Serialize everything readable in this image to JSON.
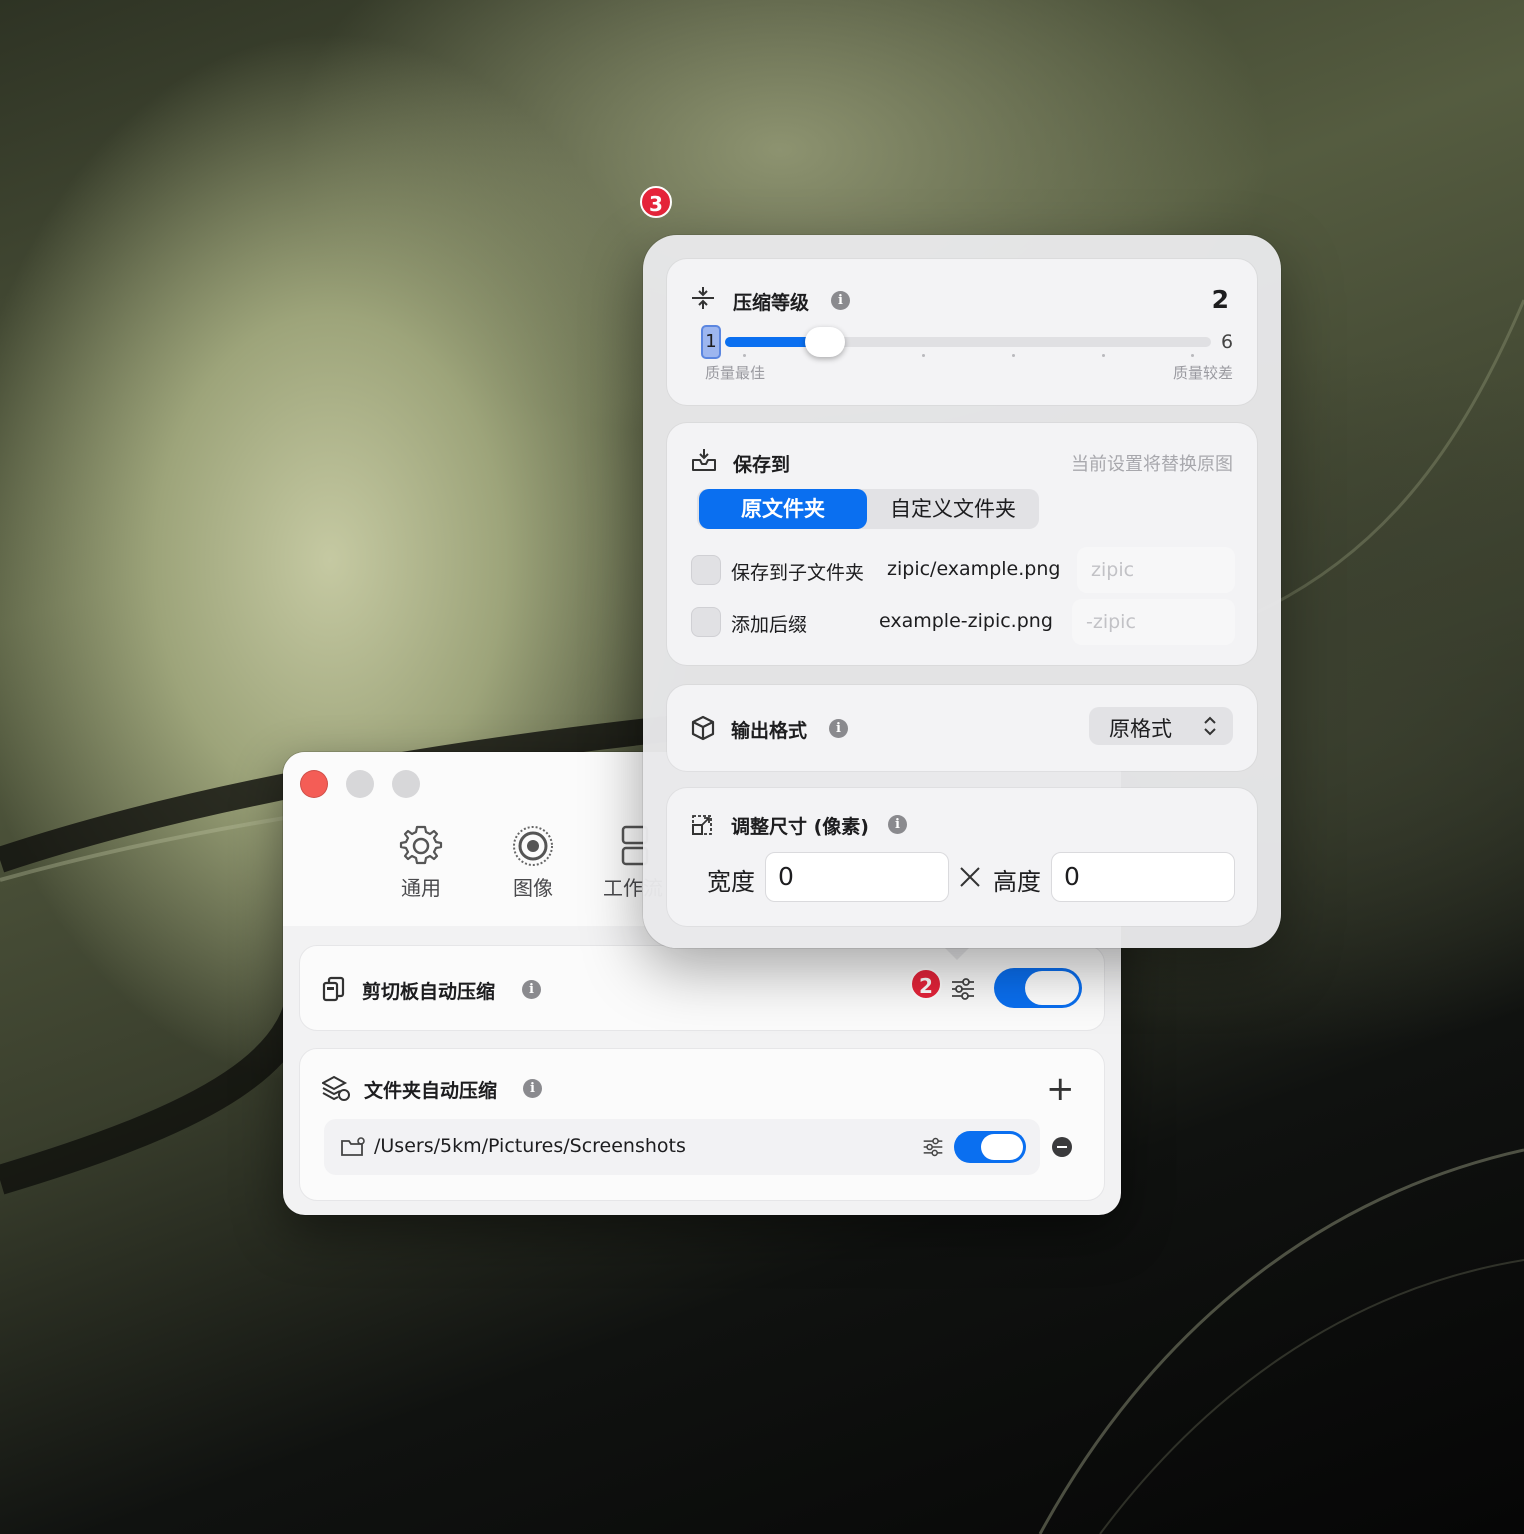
{
  "main_window": {
    "tabs": [
      {
        "label": "通用",
        "icon": "gear-icon"
      },
      {
        "label": "图像",
        "icon": "target-icon"
      },
      {
        "label": "工作流",
        "icon": "workflow-icon"
      }
    ],
    "clipboard": {
      "title": "剪切板自动压缩",
      "enabled": true
    },
    "folder": {
      "title": "文件夹自动压缩",
      "path": "/Users/5km/Pictures/Screenshots",
      "enabled": true
    }
  },
  "badges": {
    "settings_button": "2",
    "popover": "3"
  },
  "popover": {
    "compression": {
      "title": "压缩等级",
      "value": "2",
      "min_label": "1",
      "max_label": "6",
      "left_caption": "质量最佳",
      "right_caption": "质量较差",
      "level": 2,
      "min": 1,
      "max": 6
    },
    "save_to": {
      "title": "保存到",
      "note": "当前设置将替换原图",
      "options": [
        "原文件夹",
        "自定义文件夹"
      ],
      "selected": "原文件夹",
      "subfolder": {
        "label": "保存到子文件夹",
        "example": "zipic/example.png",
        "placeholder": "zipic",
        "checked": false
      },
      "suffix": {
        "label": "添加后缀",
        "example": "example-zipic.png",
        "placeholder": "-zipic",
        "checked": false
      }
    },
    "output_format": {
      "title": "输出格式",
      "value": "原格式"
    },
    "resize": {
      "title": "调整尺寸 (像素)",
      "width_label": "宽度",
      "width_value": "0",
      "height_label": "高度",
      "height_value": "0"
    }
  },
  "colors": {
    "accent": "#0a6ff0",
    "badge": "#e6243a",
    "close": "#f45d56"
  }
}
